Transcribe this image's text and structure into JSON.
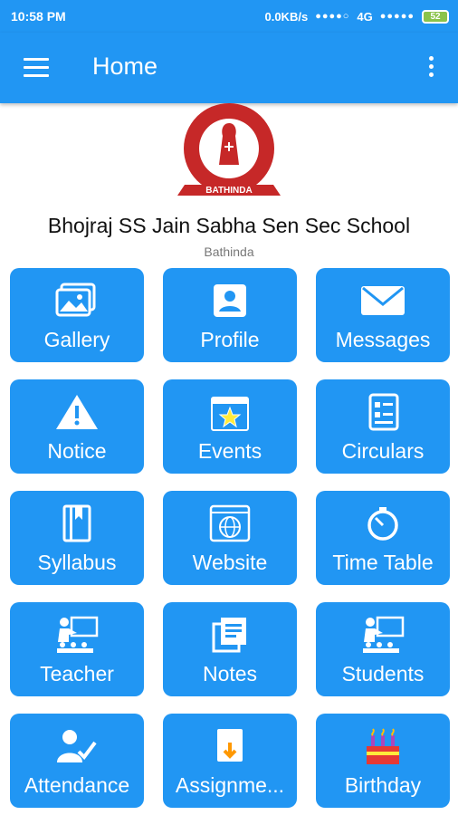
{
  "status": {
    "time": "10:58 PM",
    "speed": "0.0KB/s",
    "network": "4G",
    "battery": "52"
  },
  "appbar": {
    "title": "Home",
    "menu_icon": "hamburger-menu-icon",
    "more_icon": "more-vert-icon"
  },
  "school": {
    "name": "Bhojraj SS Jain Sabha Sen Sec School",
    "city": "Bathinda",
    "logo_text": "BATHINDA"
  },
  "tiles": [
    {
      "label": "Gallery",
      "icon": "gallery-icon"
    },
    {
      "label": "Profile",
      "icon": "profile-icon"
    },
    {
      "label": "Messages",
      "icon": "messages-icon"
    },
    {
      "label": "Notice",
      "icon": "notice-icon"
    },
    {
      "label": "Events",
      "icon": "events-icon"
    },
    {
      "label": "Circulars",
      "icon": "circulars-icon"
    },
    {
      "label": "Syllabus",
      "icon": "syllabus-icon"
    },
    {
      "label": "Website",
      "icon": "website-icon"
    },
    {
      "label": "Time Table",
      "icon": "time-table-icon"
    },
    {
      "label": "Teacher",
      "icon": "teacher-icon"
    },
    {
      "label": "Notes",
      "icon": "notes-icon"
    },
    {
      "label": "Students",
      "icon": "students-icon"
    },
    {
      "label": "Attendance",
      "icon": "attendance-icon"
    },
    {
      "label": "Assignme...",
      "icon": "assignment-icon"
    },
    {
      "label": "Birthday",
      "icon": "birthday-icon"
    }
  ],
  "colors": {
    "primary": "#2196f3",
    "logo_red": "#c62828"
  }
}
